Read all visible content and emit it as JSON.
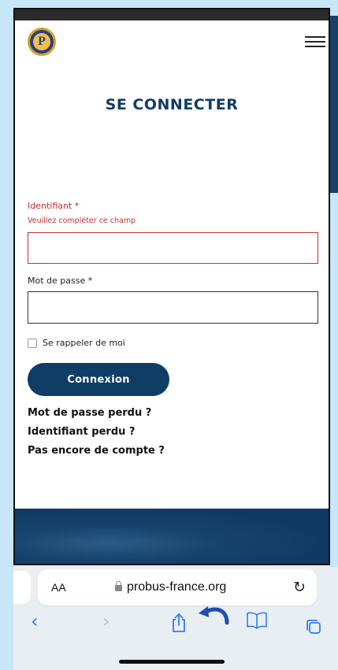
{
  "site": {
    "logo_letter": "P",
    "page_title": "SE CONNECTER"
  },
  "form": {
    "username_label": "Identifiant *",
    "username_error": "Veuillez compléter ce champ",
    "username_value": "",
    "password_label": "Mot de passe *",
    "password_value": "",
    "remember_label": "Se rappeler de moi",
    "remember_checked": false,
    "submit_label": "Connexion"
  },
  "links": {
    "lost_password": "Mot de passe perdu ?",
    "lost_username": "Identifiant perdu ?",
    "no_account": "Pas encore de compte ?"
  },
  "browser": {
    "aa_label": "AA",
    "url": "probus-france.org",
    "reload_icon": "reload-icon",
    "toolbar": [
      "back-icon",
      "forward-icon",
      "share-icon",
      "bookmarks-icon",
      "tabs-icon"
    ]
  },
  "colors": {
    "brand_blue": "#0f3d66",
    "error_red": "#c0322e",
    "ios_blue": "#2f7df6"
  }
}
